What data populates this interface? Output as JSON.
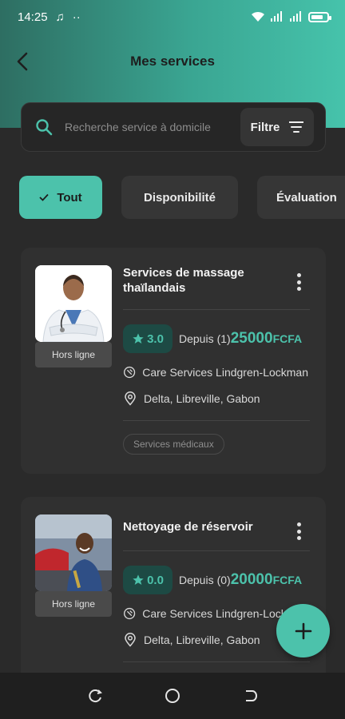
{
  "status_bar": {
    "time": "14:25",
    "music_icon": "music-note-icon",
    "dots": "··",
    "wifi_icon": "wifi-icon",
    "signal_icon": "signal-icon",
    "battery_icon": "battery-icon"
  },
  "header": {
    "title": "Mes services",
    "back_icon": "arrow-left-icon"
  },
  "search": {
    "placeholder": "Recherche service à domicile",
    "filter_label": "Filtre"
  },
  "chips": [
    {
      "label": "Tout",
      "active": true
    },
    {
      "label": "Disponibilité",
      "active": false
    },
    {
      "label": "Évaluation",
      "active": false
    }
  ],
  "services": [
    {
      "title": "Services de massage thaïlandais",
      "status": "Hors ligne",
      "rating": "3.0",
      "since_label": "Depuis",
      "count": "(1)",
      "price": "25000",
      "currency": "FCFA",
      "provider": "Care Services Lindgren-Lockman",
      "location": "Delta, Libreville, Gabon",
      "category": "Services médicaux"
    },
    {
      "title": "Nettoyage de réservoir",
      "status": "Hors ligne",
      "rating": "0.0",
      "since_label": "Depuis",
      "count": "(0)",
      "price": "20000",
      "currency": "FCFA",
      "provider": "Care Services Lindgren-Lockman",
      "location": "Delta, Libreville, Gabon"
    }
  ],
  "colors": {
    "accent": "#4cc2ab",
    "background": "#2a2a2a",
    "card": "#303030",
    "header_gradient_start": "#2e6e62",
    "header_gradient_end": "#46c3ab"
  }
}
